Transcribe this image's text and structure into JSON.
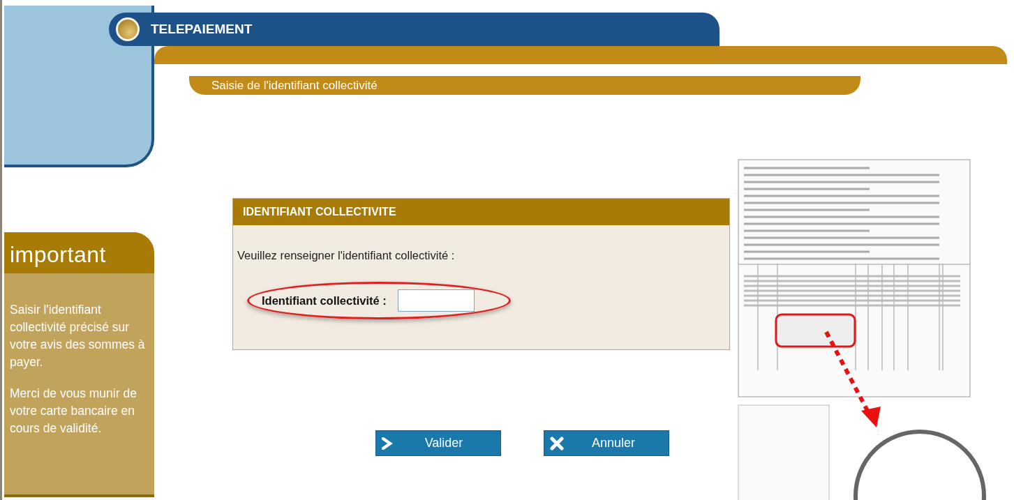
{
  "header": {
    "title": "TELEPAIEMENT",
    "subtitle": "Saisie de l'identifiant collectivité"
  },
  "sidebar": {
    "heading": "important",
    "paragraphs": [
      "Saisir l'identifiant collectivité précisé sur votre avis des sommes à payer.",
      "Merci de vous munir de votre carte bancaire en cours de validité."
    ]
  },
  "form": {
    "title": "IDENTIFIANT COLLECTIVITE",
    "instruction": "Veuillez renseigner l'identifiant collectivité :",
    "field_label": "Identifiant collectivité :",
    "highlighted": true
  },
  "buttons": [
    {
      "kind": "validate",
      "label": "Valider"
    },
    {
      "kind": "cancel",
      "label": "Annuler"
    }
  ]
}
